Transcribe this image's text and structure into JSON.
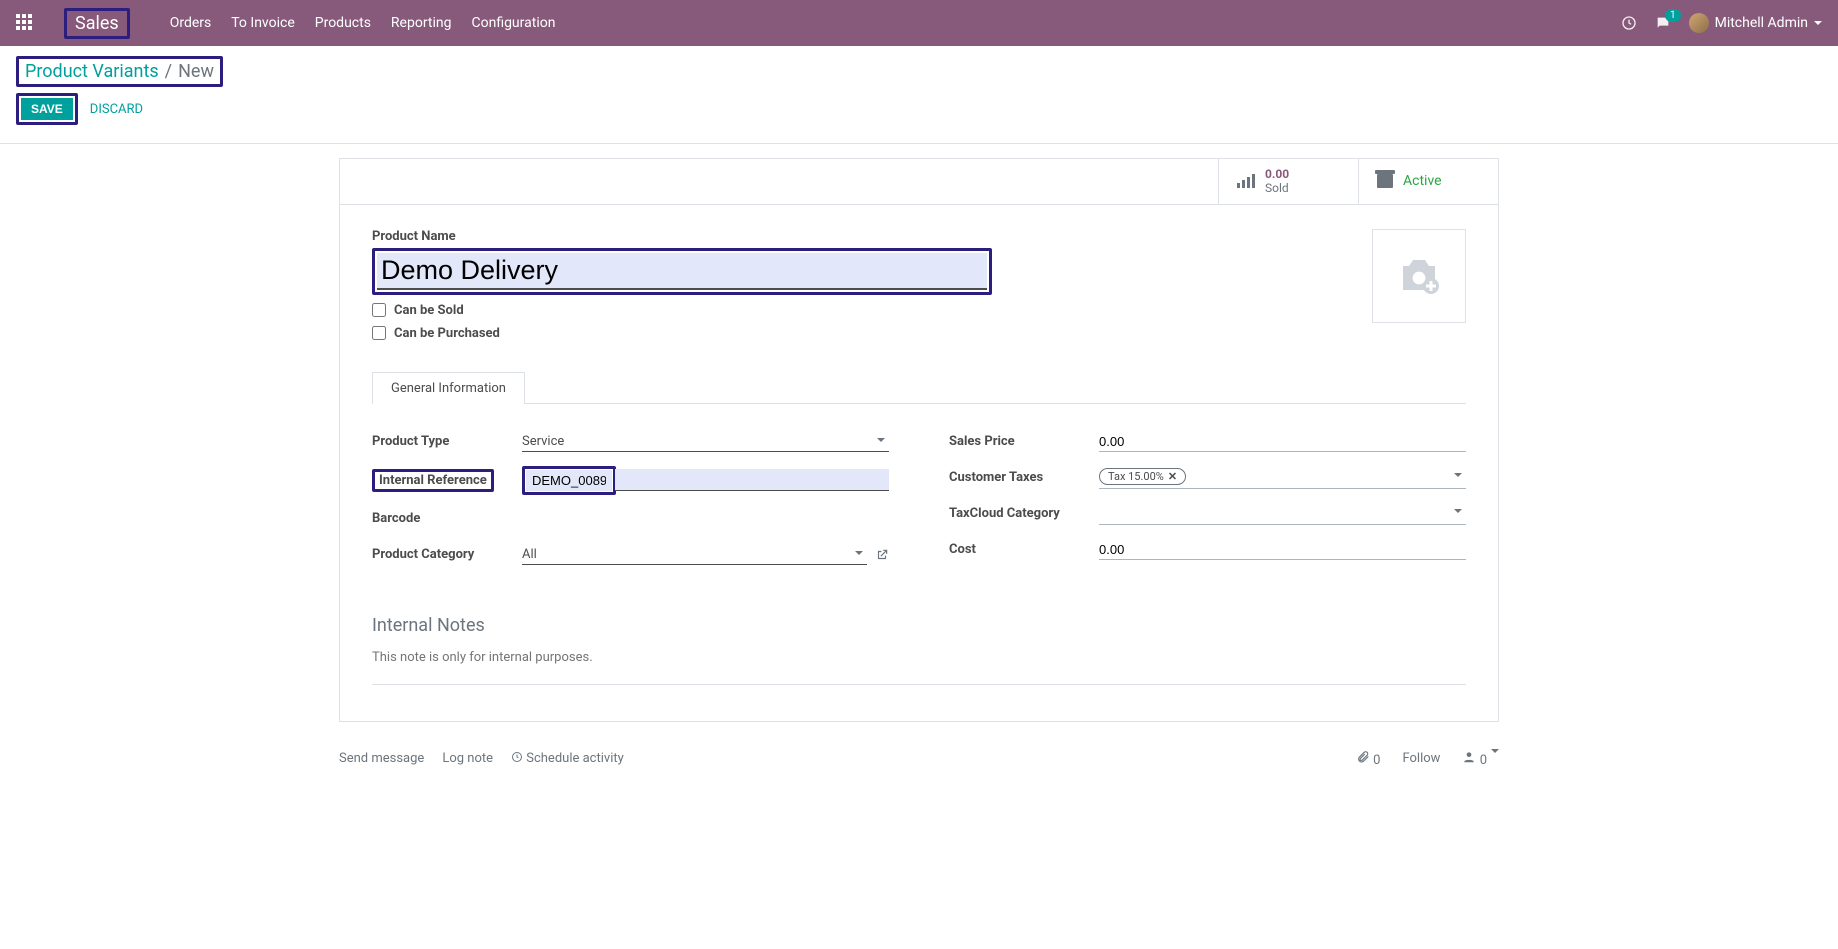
{
  "nav": {
    "brand": "Sales",
    "links": [
      "Orders",
      "To Invoice",
      "Products",
      "Reporting",
      "Configuration"
    ],
    "msg_count": "1",
    "user": "Mitchell Admin"
  },
  "breadcrumb": {
    "parent": "Product Variants",
    "sep": "/",
    "current": "New"
  },
  "actions": {
    "save": "SAVE",
    "discard": "DISCARD"
  },
  "stats": {
    "sold_value": "0.00",
    "sold_label": "Sold",
    "active_label": "Active"
  },
  "form": {
    "name_label": "Product Name",
    "name_value": "Demo Delivery",
    "can_sold": "Can be Sold",
    "can_purchased": "Can be Purchased"
  },
  "tabs": {
    "general": "General Information"
  },
  "left": {
    "product_type_label": "Product Type",
    "product_type_value": "Service",
    "internal_ref_label": "Internal Reference",
    "internal_ref_value": "DEMO_0089",
    "barcode_label": "Barcode",
    "category_label": "Product Category",
    "category_value": "All"
  },
  "right": {
    "sales_price_label": "Sales Price",
    "sales_price_value": "0.00",
    "cust_taxes_label": "Customer Taxes",
    "cust_tax_tag": "Tax 15.00%",
    "taxcloud_label": "TaxCloud Category",
    "cost_label": "Cost",
    "cost_value": "0.00"
  },
  "notes": {
    "heading": "Internal Notes",
    "placeholder": "This note is only for internal purposes."
  },
  "chatter": {
    "send": "Send message",
    "log": "Log note",
    "schedule": "Schedule activity",
    "attach_count": "0",
    "follow": "Follow",
    "followers": "0"
  }
}
